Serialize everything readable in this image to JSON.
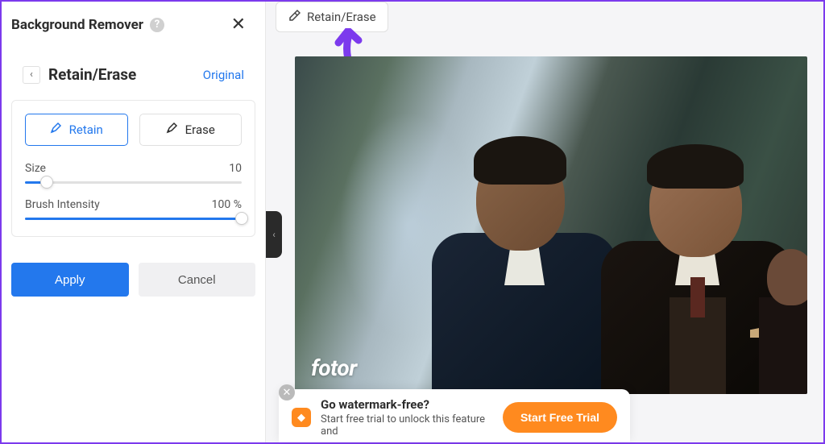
{
  "sidebar": {
    "title": "Background Remover",
    "section_title": "Retain/Erase",
    "original_link": "Original",
    "retain_label": "Retain",
    "erase_label": "Erase",
    "size_label": "Size",
    "size_value": "10",
    "size_percent": 10,
    "intensity_label": "Brush Intensity",
    "intensity_value": "100 %",
    "intensity_percent": 100,
    "apply_label": "Apply",
    "cancel_label": "Cancel"
  },
  "canvas": {
    "top_pill_label": "Retain/Erase",
    "watermark": "fotor"
  },
  "promo": {
    "title": "Go watermark-free?",
    "subtitle": "Start free trial to unlock this feature and",
    "cta": "Start Free Trial"
  }
}
